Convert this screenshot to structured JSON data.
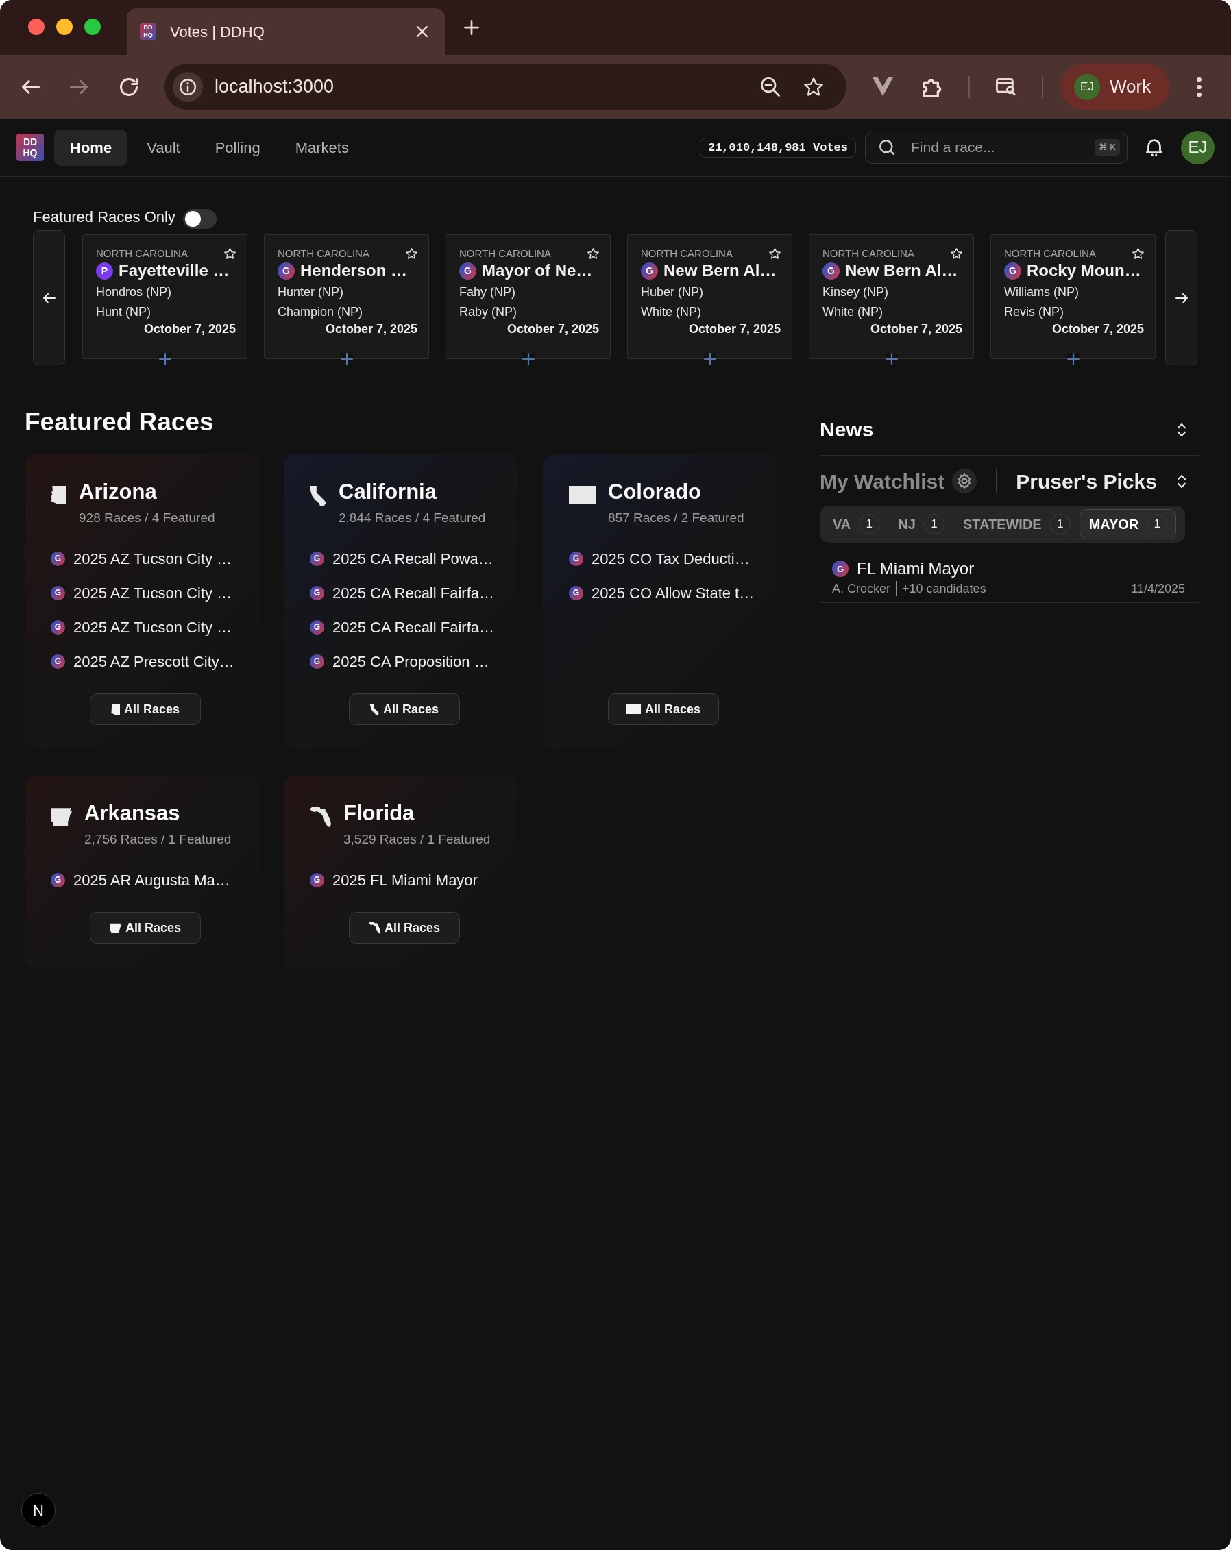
{
  "browser": {
    "tab": {
      "favicon": [
        "DD",
        "HQ"
      ],
      "title": "Votes | DDHQ"
    },
    "url": "localhost:3000",
    "profile": {
      "initials": "EJ",
      "label": "Work"
    }
  },
  "nav": {
    "logo": [
      "DD",
      "HQ"
    ],
    "links": [
      {
        "label": "Home",
        "selected": true
      },
      {
        "label": "Vault",
        "selected": false
      },
      {
        "label": "Polling",
        "selected": false
      },
      {
        "label": "Markets",
        "selected": false
      }
    ],
    "votes": "21,010,148,981 Votes",
    "search": {
      "placeholder": "Find a race...",
      "shortcut": "⌘ K"
    },
    "avatar": "EJ"
  },
  "featured_toggle": {
    "label": "Featured Races Only",
    "on": false
  },
  "carousel": [
    {
      "state": "NORTH CAROLINA",
      "starred": false,
      "badge": {
        "letter": "P",
        "kind": "solid",
        "color": "#7c3aed"
      },
      "title": "Fayetteville …",
      "candidates": [
        "Hondros (NP)",
        "Hunt (NP)"
      ],
      "date": "October 7, 2025"
    },
    {
      "state": "NORTH CAROLINA",
      "starred": false,
      "badge": {
        "letter": "G",
        "kind": "gradient"
      },
      "title": "Henderson …",
      "candidates": [
        "Hunter (NP)",
        "Champion (NP)"
      ],
      "date": "October 7, 2025"
    },
    {
      "state": "NORTH CAROLINA",
      "starred": false,
      "badge": {
        "letter": "G",
        "kind": "gradient"
      },
      "title": "Mayor of Ne…",
      "candidates": [
        "Fahy (NP)",
        "Raby (NP)"
      ],
      "date": "October 7, 2025"
    },
    {
      "state": "NORTH CAROLINA",
      "starred": false,
      "badge": {
        "letter": "G",
        "kind": "gradient"
      },
      "title": "New Bern Al…",
      "candidates": [
        "Huber (NP)",
        "White (NP)"
      ],
      "date": "October 7, 2025"
    },
    {
      "state": "NORTH CAROLINA",
      "starred": false,
      "badge": {
        "letter": "G",
        "kind": "gradient"
      },
      "title": "New Bern Al…",
      "candidates": [
        "Kinsey (NP)",
        "White (NP)"
      ],
      "date": "October 7, 2025"
    },
    {
      "state": "NORTH CAROLINA",
      "starred": false,
      "badge": {
        "letter": "G",
        "kind": "gradient"
      },
      "title": "Rocky Moun…",
      "candidates": [
        "Williams (NP)",
        "Revis (NP)"
      ],
      "date": "October 7, 2025"
    }
  ],
  "featured": {
    "title": "Featured Races",
    "states": [
      {
        "name": "Arizona",
        "color": "#241414",
        "summary": "928 Races / 4 Featured",
        "races": [
          {
            "badge": {
              "letter": "G",
              "kind": "gradient"
            },
            "title": "2025 AZ Tucson City …"
          },
          {
            "badge": {
              "letter": "G",
              "kind": "gradient"
            },
            "title": "2025 AZ Tucson City …"
          },
          {
            "badge": {
              "letter": "G",
              "kind": "gradient"
            },
            "title": "2025 AZ Tucson City …"
          },
          {
            "badge": {
              "letter": "G",
              "kind": "gradient"
            },
            "title": "2025 AZ Prescott City…"
          }
        ],
        "button": "All Races"
      },
      {
        "name": "California",
        "color": "#151827",
        "summary": "2,844 Races / 4 Featured",
        "races": [
          {
            "badge": {
              "letter": "G",
              "kind": "gradient"
            },
            "title": "2025 CA Recall Powa…"
          },
          {
            "badge": {
              "letter": "G",
              "kind": "gradient"
            },
            "title": "2025 CA Recall Fairfa…"
          },
          {
            "badge": {
              "letter": "G",
              "kind": "gradient"
            },
            "title": "2025 CA Recall Fairfa…"
          },
          {
            "badge": {
              "letter": "G",
              "kind": "gradient"
            },
            "title": "2025 CA Proposition …"
          }
        ],
        "button": "All Races"
      },
      {
        "name": "Colorado",
        "color": "#151827",
        "summary": "857 Races / 2 Featured",
        "races": [
          {
            "badge": {
              "letter": "G",
              "kind": "gradient"
            },
            "title": "2025 CO Tax Deducti…"
          },
          {
            "badge": {
              "letter": "G",
              "kind": "gradient"
            },
            "title": "2025 CO Allow State t…"
          }
        ],
        "button": "All Races"
      },
      {
        "name": "Arkansas",
        "color": "#241414",
        "summary": "2,756 Races / 1 Featured",
        "races": [
          {
            "badge": {
              "letter": "G",
              "kind": "gradient"
            },
            "title": "2025 AR Augusta Ma…"
          }
        ],
        "button": "All Races"
      },
      {
        "name": "Florida",
        "color": "#241414",
        "summary": "3,529 Races / 1 Featured",
        "races": [
          {
            "badge": {
              "letter": "G",
              "kind": "gradient"
            },
            "title": "2025 FL Miami Mayor"
          }
        ],
        "button": "All Races"
      }
    ]
  },
  "news": {
    "title": "News",
    "lists": [
      {
        "label": "My Watchlist",
        "selected": false
      },
      {
        "label": "Pruser's Picks",
        "selected": true
      }
    ],
    "filters": [
      {
        "label": "VA",
        "count": "1",
        "selected": false
      },
      {
        "label": "NJ",
        "count": "1",
        "selected": false
      },
      {
        "label": "STATEWIDE",
        "count": "1",
        "selected": false
      },
      {
        "label": "MAYOR",
        "count": "1",
        "selected": true
      }
    ],
    "items": [
      {
        "badge": {
          "letter": "G",
          "kind": "gradient"
        },
        "title": "FL Miami Mayor",
        "candidate": "A. Crocker",
        "others": "+10 candidates",
        "date": "11/4/2025"
      }
    ]
  },
  "dev_badge": "N"
}
